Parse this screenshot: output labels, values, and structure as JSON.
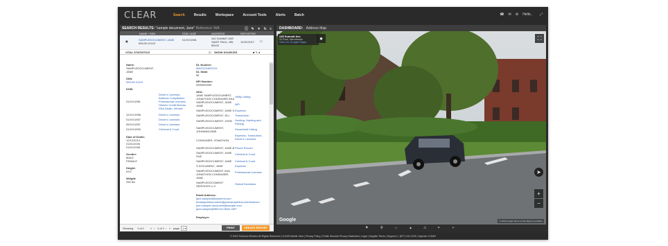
{
  "app": {
    "logo": "CLEAR"
  },
  "nav": {
    "items": [
      "Search",
      "Results",
      "Workspace",
      "Account Tools",
      "Alerts",
      "Batch"
    ],
    "active": "Search"
  },
  "user": {
    "greeting": "Hello,"
  },
  "search_panel": {
    "title": "SEARCH RESULTS:",
    "query": "\"sample document, Jane\"",
    "reference": "Reference: N/A",
    "columns": {
      "name": "NAME / SSN",
      "dob": "DOB / AGE",
      "address": "ADDRESS",
      "reported": "REPORTED"
    },
    "result": {
      "name": "SAMPLEDOCUMENT, JANE",
      "ssn": "999-99-XXXX",
      "dob": "01/XX/1981",
      "address": [
        "240 SUMMIT AVE",
        "SAINT PAUL, MN",
        "55102"
      ],
      "reported": "12/31/2017"
    },
    "subtabs": {
      "vital": "VITAL STATISTICS",
      "sources": "SHOW SOURCES"
    }
  },
  "vitals": {
    "name_label": "Name:",
    "name": [
      "SAMPLEDOCUMENT,",
      "JANE"
    ],
    "ssn_label": "SSN:",
    "ssn": "999-99-XXXX",
    "dob_label": "DOB:",
    "dob_rows": [
      {
        "date": "01/XX/1981",
        "sources": [
          "Driver's Licenses,",
          "Address Compilation,",
          "Professional Licenses,",
          "Historic Credit Bureau,",
          "SSA Death, Vehicle"
        ]
      },
      {
        "date": "12/XX/1958",
        "sources": [
          "Driver's Licenses"
        ]
      },
      {
        "date": "01/XX/1957",
        "sources": [
          "Driver's Licenses"
        ]
      },
      {
        "date": "05/XX/1957",
        "sources": [
          "Driver's Licenses"
        ]
      },
      {
        "date": "01/XX/1993",
        "sources": [
          "Criminal & Court"
        ]
      }
    ],
    "death_label": "Date of Death:",
    "death": [
      "12/12/2014",
      "01/01/2009",
      "01/01/2008"
    ],
    "gender_label": "Gender:",
    "gender": [
      "MALE",
      "FEMALE"
    ],
    "height_label": "Height:",
    "height": "6'01\"",
    "weight_label": "Weight:",
    "weight": "250 lbs"
  },
  "vitals_right": {
    "dl_label": "DL Number:",
    "dl": "MNS12345XXXX",
    "dl_state_label": "DL State:",
    "dl_state": "MI",
    "npi_label": "NPI Number:",
    "npi": "9999999999",
    "aka_label": "AKA:",
    "aka": [
      {
        "name": [
          "JANE SAMPLEDOCUMENT,",
          "JONATHON CONSUMER AKA"
        ],
        "src": "Utility Listing"
      },
      {
        "name": [
          "SAMPLEDOCUMENT, JANE",
          "JANE"
        ],
        "src": "NPI"
      },
      {
        "name": [
          "SAMPLEDOCUMENT, JANE S"
        ],
        "src": "Experian"
      },
      {
        "name": [
          "SAMPLEDOCUMENT, JILL"
        ],
        "src": "TransUnion"
      },
      {
        "name": [
          "SAMPLEDOCUMENT, JOHN"
        ],
        "src": "Hunting, Hunting and Fishing"
      },
      {
        "name": [
          "SAMPLEDOCUMENT,",
          "JOHNANDJANE"
        ],
        "src": "Household Listing"
      },
      {
        "name": [
          "CONSUMER, JONATHON"
        ],
        "src": "Experian, TransUnion, Driver's Licenses"
      },
      {
        "name": [
          "SAMPLEDOCUMENT, JANE B"
        ],
        "src": "Phone Record"
      },
      {
        "name": [
          "SAMPLEDOCUMENT, JANE",
          "SUE"
        ],
        "src": "Criminal & Court"
      },
      {
        "name": [
          "SAMPLEDOCUMENT, JANE"
        ],
        "src": "Criminal & Court"
      },
      {
        "name": [
          "S DOCUMENT, JANE"
        ],
        "src": "Experian"
      },
      {
        "name": [
          "SAMPLEDOCUMENT, AKA",
          "JONATHON CONSUMER,",
          "JANE"
        ],
        "src": "Professional Licenses"
      },
      {
        "name": [
          "SAMPLEDOCUMENT",
          "SERVICES LLC"
        ],
        "src": "Global Sanctions"
      }
    ],
    "email_label": "Email Address:",
    "emails": [
      "jane.sample@keymnmt.com",
      "dreamjanedocument@janesampledocumentdotcom",
      "john.sample.document@sample.com",
      "jane.sample@SBCGLOBAL.NET"
    ],
    "employer_label": "Employer:"
  },
  "pager": {
    "showing": "Showing",
    "range": "1 of 1",
    "nav_text": "1 of 1",
    "page_label": "page",
    "page": "1",
    "print": "PRINT",
    "create_report": "CREATE REPORT"
  },
  "dashboard": {
    "title": "DASHBOARD:",
    "subtitle": "Address Map",
    "card": {
      "line1": "245 Summit Ave",
      "line2": "St Paul, Minnesota",
      "line3": "View on Google Maps"
    },
    "google": "Google",
    "map_footer": "© 2019 Google   Terms of Use   Report a problem",
    "toolbar_icons": [
      "flag-icon",
      "pin-icon",
      "globe-icon",
      "tree-icon",
      "warning-icon",
      "link-icon",
      "pointer-icon"
    ],
    "active_icon": "pin-icon"
  },
  "footer": {
    "text": "© 2019 Thomson Reuters  All Rights Reserved  |  CLEAR Mobile View  |  Privacy Policy  |  Public Records Privacy Statement  |  Legal  |  Supplier Terms  |  Support  |  1 (877) 242-1229  |  Improve CLEAR"
  },
  "colors": {
    "accent": "#f29a2e",
    "link": "#2a64b8",
    "chrome": "#2a2a2a"
  }
}
